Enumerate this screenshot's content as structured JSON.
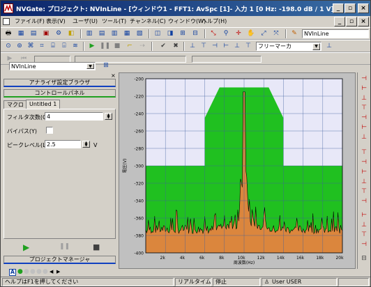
{
  "window": {
    "title": "NVGate: プロジェクト: NVInLine - [ウィンドウ1 - FFT1: AvSpc [1]- 入力 1 [0 Hz: -198.0 dB / 1 V]]",
    "minimize": "_",
    "restore": "▫",
    "close": "×"
  },
  "menu": [
    "ファイル(F)",
    "表示(V)",
    "ユーザ(U)",
    "ツール(T)",
    "チャンネル(C)",
    "ウィンドウ(W)",
    "ヘルプ(H)"
  ],
  "toolbar": {
    "project_name": "NVInLine",
    "marker_mode": "フリーマーカ"
  },
  "project_select": "NVInLine",
  "left_panel": {
    "analyzer_browser": "アナライザ設定ブラウザ",
    "control_panel": "コントロールパネル",
    "tabs": [
      "マクロ",
      "Untitled 1"
    ],
    "fields": [
      {
        "label": "フィルタ次数(O)",
        "value": "4",
        "unit": ""
      },
      {
        "label": "バイパス(Y)",
        "value": "",
        "unit": ""
      },
      {
        "label": "ピークレベル(L)",
        "value": "2.5",
        "unit": "V"
      }
    ],
    "project_manager": "プロジェクトマネージャ"
  },
  "chart_data": {
    "type": "line",
    "xlabel": "周波数(Hz)",
    "ylabel": "電圧(V)",
    "y_ticks": [
      "-200",
      "-220",
      "-240",
      "-260",
      "-280",
      "-300",
      "-320",
      "-340",
      "-360",
      "-380",
      "-400"
    ],
    "x_ticks": [
      "2k",
      "4k",
      "6k",
      "8k",
      "10k",
      "12k",
      "14k",
      "16k",
      "18k",
      "20k"
    ],
    "xlim": [
      0,
      20000
    ],
    "ylim": [
      -400,
      -200
    ],
    "grid": true,
    "template_upper": [
      {
        "x": 0,
        "y": -300
      },
      {
        "x": 6000,
        "y": -300
      },
      {
        "x": 6000,
        "y": -245
      },
      {
        "x": 7500,
        "y": -210
      },
      {
        "x": 12500,
        "y": -210
      },
      {
        "x": 14000,
        "y": -245
      },
      {
        "x": 14000,
        "y": -300
      },
      {
        "x": 20000,
        "y": -300
      }
    ],
    "spectrum_peak": {
      "x": 10000,
      "y": -215
    },
    "noise_floor": -378,
    "colors": {
      "plot_bg": "#e8e8f8",
      "template_fill": "#20c020",
      "lower_fill": "#f08040",
      "trace": "#000000",
      "grid": "#4060a0"
    }
  },
  "status": {
    "help": "ヘルプはF1を押してください",
    "mode": "リアルタイム",
    "state": "停止",
    "user": "User USER"
  }
}
